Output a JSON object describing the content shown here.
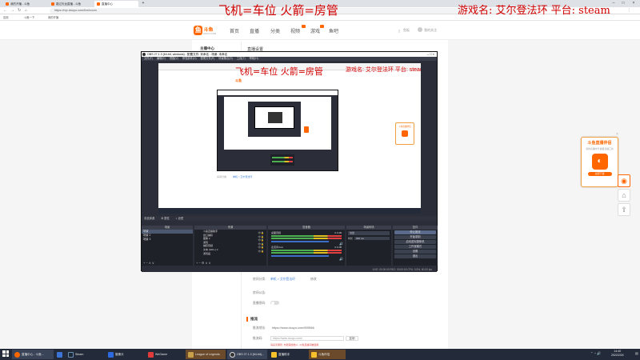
{
  "browser": {
    "tabs": [
      {
        "label": "我的开播 - 斗鱼",
        "active": false
      },
      {
        "label": "路过天龙直播 - 斗鱼",
        "active": false
      },
      {
        "label": "直播中心",
        "active": true
      }
    ],
    "url": "https://mp.douyu.com/live/room",
    "bookmarks": [
      {
        "label": "应用"
      },
      {
        "label": "斗鱼一下"
      },
      {
        "label": "我的开播"
      }
    ]
  },
  "site": {
    "logo_text": "斗鱼",
    "logo_sub": "DOUYU.COM",
    "nav": [
      "首页",
      "直播",
      "分类",
      "视频",
      "游戏",
      "鱼吧"
    ],
    "user_label": "鱼板",
    "follow_label": "我的关注"
  },
  "overlay": {
    "left": "飞机=车位  火箭=房管",
    "right": "游戏名: 艾尔登法环  平台: steam"
  },
  "side_menu": {
    "title": "主播中心"
  },
  "section": {
    "title": "直播设置"
  },
  "obs": {
    "title": "OBS 27.1.3 (64-bit, windows) - 配置文件: 未命名 - 场景: 未命名",
    "menu": [
      "文件(F)",
      "编辑(E)",
      "视图(V)",
      "停靠部件(D)",
      "配置文件(P)",
      "场景集合(S)",
      "工具(T)",
      "帮助(H)"
    ],
    "source_bar_label": "未选择源",
    "props_label": "属性",
    "filters_label": "滤镜",
    "panels": {
      "scenes": "场景",
      "sources": "来源",
      "mixer": "混音器",
      "transitions": "场景转场",
      "controls": "控件"
    },
    "scenes": [
      "场景",
      "场景 2",
      "场景 3"
    ],
    "sources": [
      "斗鱼直播助手",
      "窗口捕获",
      "图像 2",
      "游戏",
      "捕获音频",
      "文本 (GDI+) 2",
      "游戏画"
    ],
    "mixer_tracks": [
      {
        "name": "桌面音频",
        "db": "0.0 dB"
      },
      {
        "name": "麦克风/Aux",
        "db": "0.0 dB"
      }
    ],
    "transition": {
      "type_label": "淡出",
      "duration_label": "时长",
      "duration_value": "300 ms"
    },
    "controls": [
      "停止推流",
      "开始录制",
      "启动虚拟摄像机",
      "工作室模式",
      "设置",
      "退出"
    ],
    "status": "LIVE: 00:00:00  REC: 00:00:00  CPU: 0.5%, 60.00 fps"
  },
  "form": {
    "room_label": "房间分类:",
    "room_value": "单机 > 艾尔登法环",
    "room_action": "修改",
    "notice_label": "房间公告:",
    "password_label": "直播密码:",
    "stream_title": "推流",
    "push_url_label": "推流地址:",
    "push_url_value": "https://www.douyu.com/995566",
    "push_code_label": "推流码:",
    "push_code_value": "https://www.douyu.com/",
    "copy_label": "复制",
    "warning": "请妥善保管, 勿泄露给他人, 以免直播间被盗用"
  },
  "ad": {
    "title": "斗鱼直播伴侣",
    "subtitle": "新的直播时代 超级直播工具",
    "button": "立即下载"
  },
  "taskbar": {
    "items": [
      {
        "label": "直播中心 - 斗鱼...",
        "active": true
      },
      {
        "label": "",
        "active": false
      },
      {
        "label": "Steam",
        "active": false
      },
      {
        "label": "摄像头",
        "active": false
      },
      {
        "label": "WeGame",
        "active": false
      },
      {
        "label": "League of Legends",
        "active": true
      },
      {
        "label": "OBS 27.1.3 (64-bit)...",
        "active": true
      },
      {
        "label": "直播助手",
        "active": false
      },
      {
        "label": "斗鱼伴侣",
        "active": false
      }
    ],
    "time": "14:40",
    "date": "2022/2/24"
  },
  "colors": {
    "brand": "#ff6600",
    "overlay": "#d20000",
    "obs_bg": "#2b2e38"
  }
}
